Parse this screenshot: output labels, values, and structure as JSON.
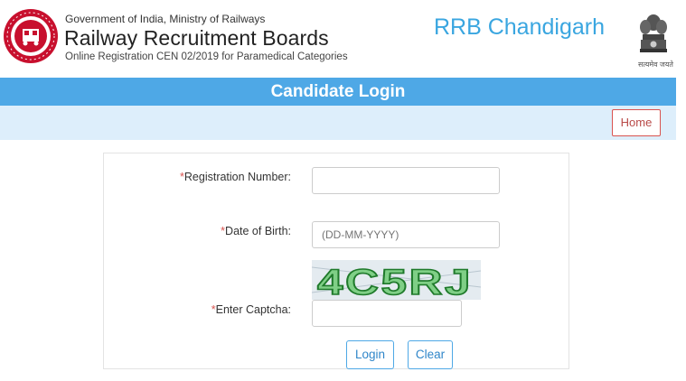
{
  "header": {
    "org_line1": "Government of India, Ministry of Railways",
    "org_title": "Railway Recruitment Boards",
    "org_sub": "Online Registration CEN 02/2019 for Paramedical Categories",
    "rrb_name": "RRB Chandigarh",
    "emblem_caption": "सत्यमेव जयते"
  },
  "title_bar": {
    "label": "Candidate Login"
  },
  "nav": {
    "home_label": "Home"
  },
  "form": {
    "registration": {
      "required_mark": "*",
      "label": "Registration Number:",
      "value": "",
      "placeholder": ""
    },
    "dob": {
      "required_mark": "*",
      "label": "Date of Birth:",
      "value": "",
      "placeholder": "(DD-MM-YYYY)"
    },
    "captcha": {
      "text": "4C5RJ",
      "required_mark": "*",
      "label": "Enter Captcha:",
      "value": "",
      "placeholder": ""
    },
    "login_label": "Login",
    "clear_label": "Clear"
  },
  "colors": {
    "accent_blue": "#4ea8e6",
    "nav_bg": "#ddeefb",
    "home_border": "#d9534f",
    "captcha_green": "#2e8b3a"
  }
}
